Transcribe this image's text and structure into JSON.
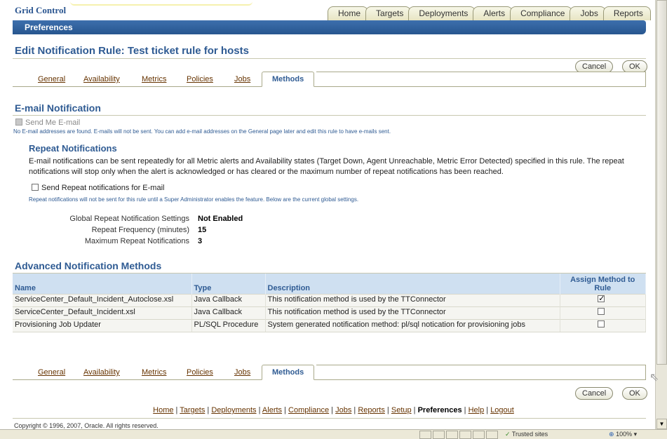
{
  "header": {
    "brand": "Grid Control",
    "tabs": [
      "Home",
      "Targets",
      "Deployments",
      "Alerts",
      "Compliance",
      "Jobs",
      "Reports"
    ],
    "sub_bar": "Preferences"
  },
  "page": {
    "title": "Edit Notification Rule: Test ticket rule for hosts",
    "cancel_label": "Cancel",
    "ok_label": "OK"
  },
  "subtabs": {
    "items": [
      "General",
      "Availability",
      "Metrics",
      "Policies",
      "Jobs"
    ],
    "active": "Methods"
  },
  "email": {
    "heading": "E-mail Notification",
    "send_me_label": "Send Me E-mail",
    "note": "No E-mail addresses are found. E-mails will not be sent. You can add e-mail addresses on the General page later and edit this rule to have e-mails sent.",
    "repeat_heading": "Repeat Notifications",
    "repeat_desc": "E-mail notifications can be sent repeatedly for all Metric alerts and Availability states (Target Down, Agent Unreachable, Metric Error Detected) specified in this rule. The repeat notifications will stop only when the alert is acknowledged or has cleared or the maximum number of repeat notifications has been reached.",
    "send_repeat_label": "Send Repeat notifications for E-mail",
    "repeat_note": "Repeat notifications will not be sent for this rule until a Super Administrator enables the feature. Below are the current global settings.",
    "settings": [
      {
        "label": "Global Repeat Notification Settings",
        "value": "Not Enabled"
      },
      {
        "label": "Repeat Frequency (minutes)",
        "value": "15"
      },
      {
        "label": "Maximum Repeat Notifications",
        "value": "3"
      }
    ]
  },
  "advanced": {
    "heading": "Advanced Notification Methods",
    "columns": [
      "Name",
      "Type",
      "Description",
      "Assign Method to Rule"
    ],
    "rows": [
      {
        "name": "ServiceCenter_Default_Incident_Autoclose.xsl",
        "type": "Java Callback",
        "description": "This notification method is used by the TTConnector",
        "assigned": true
      },
      {
        "name": "ServiceCenter_Default_Incident.xsl",
        "type": "Java Callback",
        "description": "This notification method is used by the TTConnector",
        "assigned": false
      },
      {
        "name": "Provisioning Job Updater",
        "type": "PL/SQL Procedure",
        "description": "System generated notification method: pl/sql notication for provisioning jobs",
        "assigned": false
      }
    ]
  },
  "footer": {
    "links": [
      "Home",
      "Targets",
      "Deployments",
      "Alerts",
      "Compliance",
      "Jobs",
      "Reports",
      "Setup",
      "Preferences",
      "Help",
      "Logout"
    ],
    "current": "Preferences",
    "copyright": "Copyright © 1996, 2007, Oracle. All rights reserved."
  },
  "statusbar": {
    "zone": "Trusted sites",
    "zoom": "100%"
  }
}
